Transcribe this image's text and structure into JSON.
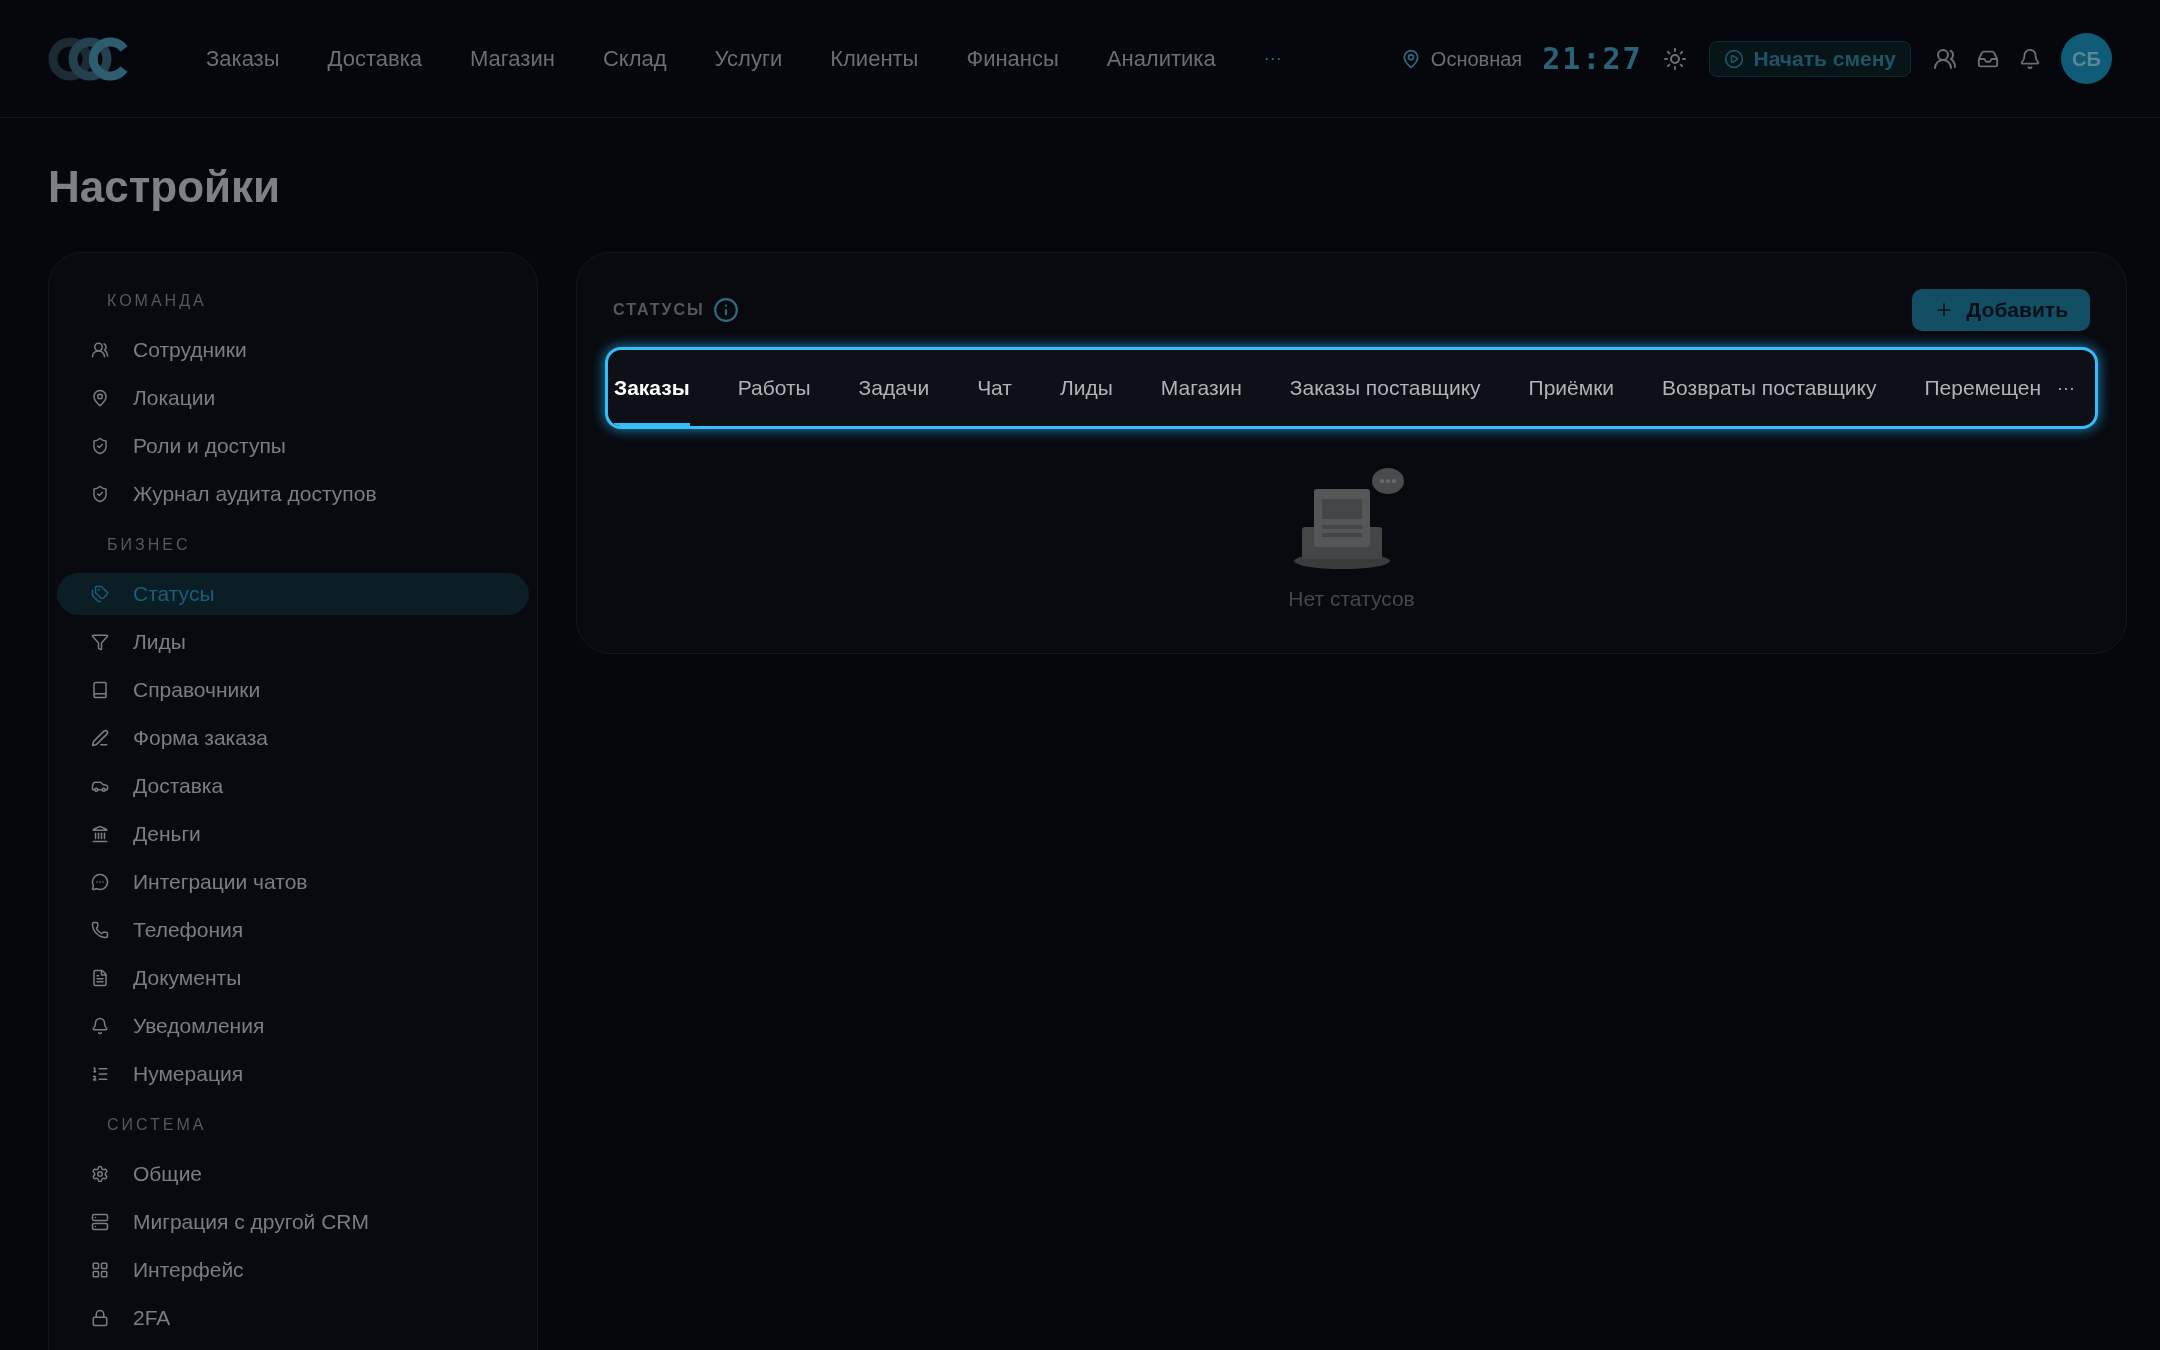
{
  "header": {
    "nav": [
      {
        "label": "Заказы"
      },
      {
        "label": "Доставка"
      },
      {
        "label": "Магазин"
      },
      {
        "label": "Склад"
      },
      {
        "label": "Услуги"
      },
      {
        "label": "Клиенты"
      },
      {
        "label": "Финансы"
      },
      {
        "label": "Аналитика"
      }
    ],
    "more": "···",
    "location": "Основная",
    "time": "21:27",
    "shift_button": "Начать смену",
    "avatar": "СБ"
  },
  "page_title": "Настройки",
  "sidebar": {
    "sections": [
      {
        "title": "КОМАНДА",
        "items": [
          {
            "label": "Сотрудники",
            "selected": false
          },
          {
            "label": "Локации",
            "selected": false
          },
          {
            "label": "Роли и доступы",
            "selected": false
          },
          {
            "label": "Журнал аудита доступов",
            "selected": false
          }
        ]
      },
      {
        "title": "БИЗНЕС",
        "items": [
          {
            "label": "Статусы",
            "selected": true
          },
          {
            "label": "Лиды",
            "selected": false
          },
          {
            "label": "Справочники",
            "selected": false
          },
          {
            "label": "Форма заказа",
            "selected": false
          },
          {
            "label": "Доставка",
            "selected": false
          },
          {
            "label": "Деньги",
            "selected": false
          },
          {
            "label": "Интеграции чатов",
            "selected": false
          },
          {
            "label": "Телефония",
            "selected": false
          },
          {
            "label": "Документы",
            "selected": false
          },
          {
            "label": "Уведомления",
            "selected": false
          },
          {
            "label": "Нумерация",
            "selected": false
          }
        ]
      },
      {
        "title": "СИСТЕМА",
        "items": [
          {
            "label": "Общие",
            "selected": false
          },
          {
            "label": "Миграция с другой CRM",
            "selected": false
          },
          {
            "label": "Интерфейс",
            "selected": false
          },
          {
            "label": "2FA",
            "selected": false
          }
        ]
      }
    ]
  },
  "statuses": {
    "title": "СТАТУСЫ",
    "add_button": "Добавить",
    "tabs": [
      {
        "label": "Заказы",
        "selected": true
      },
      {
        "label": "Работы",
        "selected": false
      },
      {
        "label": "Задачи",
        "selected": false
      },
      {
        "label": "Чат",
        "selected": false
      },
      {
        "label": "Лиды",
        "selected": false
      },
      {
        "label": "Магазин",
        "selected": false
      },
      {
        "label": "Заказы поставщику",
        "selected": false
      },
      {
        "label": "Приёмки",
        "selected": false
      },
      {
        "label": "Возвраты поставщику",
        "selected": false
      },
      {
        "label": "Перемещен",
        "selected": false
      }
    ],
    "tabs_more": "···",
    "empty_text": "Нет статусов"
  }
}
